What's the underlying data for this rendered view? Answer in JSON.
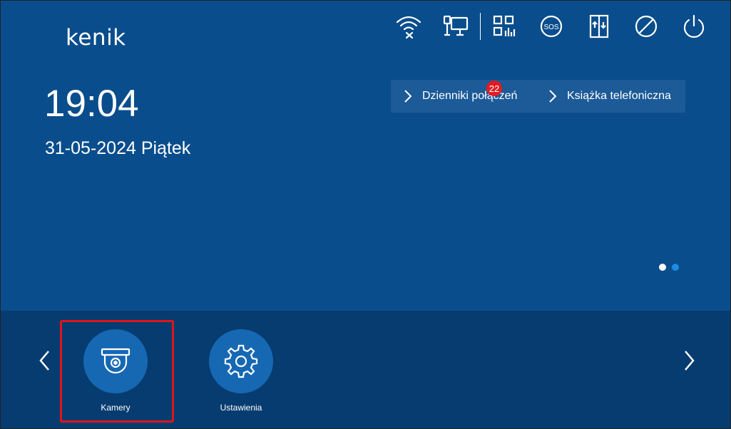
{
  "brand": {
    "logo_text": "kenik"
  },
  "clock": {
    "time": "19:04",
    "date": "31-05-2024 Piątek"
  },
  "status_icons": [
    "wifi-off-icon",
    "network-monitor-icon",
    "qr-code-icon",
    "sos-icon",
    "elevator-icon",
    "do-not-disturb-icon",
    "power-icon"
  ],
  "sos_label": "SOS",
  "quick_links": {
    "call_logs": "Dzienniki połączeń",
    "call_logs_badge": "22",
    "phonebook": "Książka telefoniczna"
  },
  "pager": {
    "total": 2,
    "active_index": 0
  },
  "apps": [
    {
      "label": "Kamery",
      "icon": "camera-icon",
      "selected": true
    },
    {
      "label": "Ustawienia",
      "icon": "settings-icon",
      "selected": false
    }
  ],
  "colors": {
    "background": "#094d8c",
    "bottom_bar": "#073c70",
    "app_circle": "#1668b3",
    "badge": "#e21b22",
    "highlight": "#e0141a",
    "dot_active": "#ffffff",
    "dot_inactive": "#1e8be0"
  }
}
